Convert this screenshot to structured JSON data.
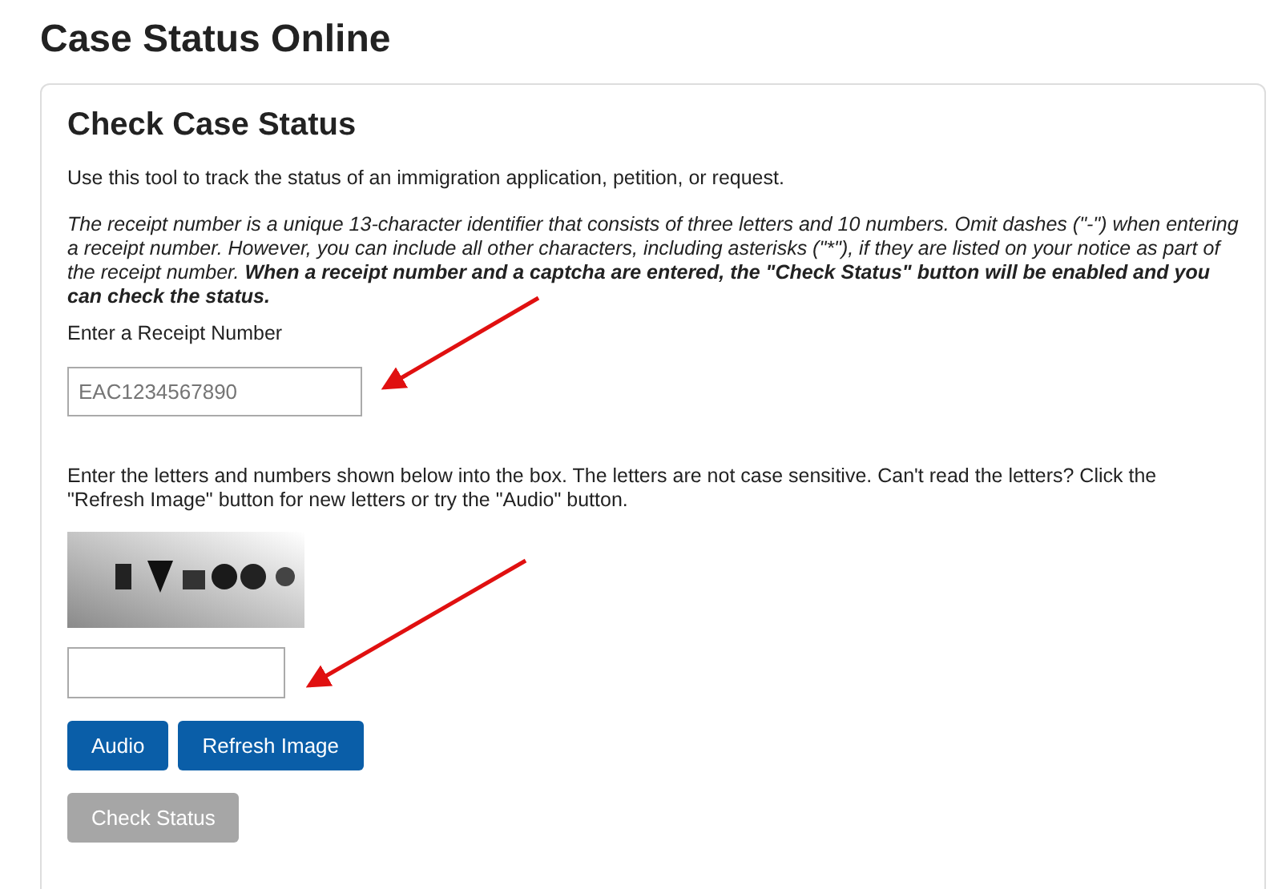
{
  "page_title": "Case Status Online",
  "card": {
    "title": "Check Case Status",
    "intro": "Use this tool to track the status of an immigration application, petition, or request.",
    "note": "The receipt number is a unique 13-character identifier that consists of three letters and 10 numbers. Omit dashes (\"-\") when entering a receipt number. However, you can include all other characters, including asterisks (\"*\"), if they are listed on your notice as part of the receipt number. **When a receipt number and a captcha are entered, the \"Check Status\" button will be enabled and you can check the status.**",
    "receipt_label": "Enter a Receipt Number",
    "receipt_field": {
      "placeholder": "EAC1234567890"
    },
    "captcha_text": "Enter the letters and numbers shown below into the box. The letters are not case sensitive. Can't read the letters? Click the \"Refresh Image\" button for new letters or try the \"Audio\" button.",
    "buttons": [
      {
        "label": "Audio",
        "disabled": false
      },
      {
        "label": "Refresh Image",
        "disabled": false
      }
    ],
    "submit": {
      "label": "Check Status",
      "disabled": true
    }
  }
}
